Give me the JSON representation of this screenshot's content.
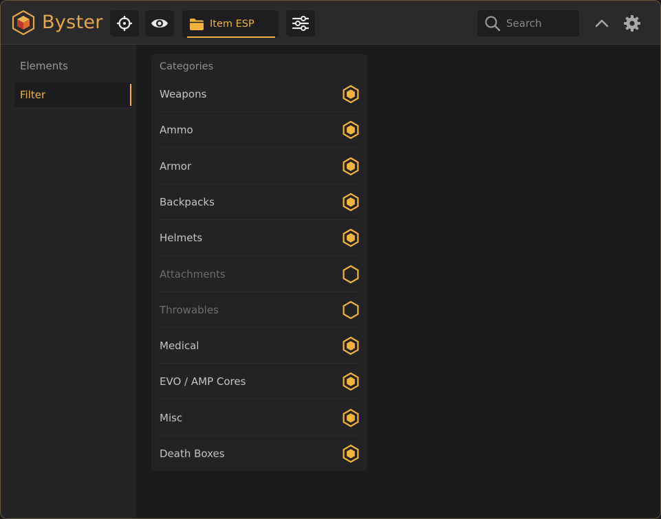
{
  "app": {
    "brand": "Byster"
  },
  "topbar": {
    "icons": [
      "crosshair-icon",
      "eye-icon",
      "folder-icon",
      "sliders-icon"
    ],
    "active_tab": "Item ESP",
    "search_placeholder": "Search"
  },
  "sidebar": {
    "items": [
      {
        "label": "Elements",
        "active": false
      },
      {
        "label": "Filter",
        "active": true
      }
    ]
  },
  "main": {
    "panel_title": "Categories",
    "categories": [
      {
        "label": "Weapons",
        "enabled": true
      },
      {
        "label": "Ammo",
        "enabled": true
      },
      {
        "label": "Armor",
        "enabled": true
      },
      {
        "label": "Backpacks",
        "enabled": true
      },
      {
        "label": "Helmets",
        "enabled": true
      },
      {
        "label": "Attachments",
        "enabled": false
      },
      {
        "label": "Throwables",
        "enabled": false
      },
      {
        "label": "Medical",
        "enabled": true
      },
      {
        "label": "EVO / AMP Cores",
        "enabled": true
      },
      {
        "label": "Misc",
        "enabled": true
      },
      {
        "label": "Death Boxes",
        "enabled": true
      }
    ]
  },
  "colors": {
    "accent": "#f3b33d",
    "brand": "#e7a64a",
    "background": "#1b1b1d",
    "panel": "#232325"
  }
}
